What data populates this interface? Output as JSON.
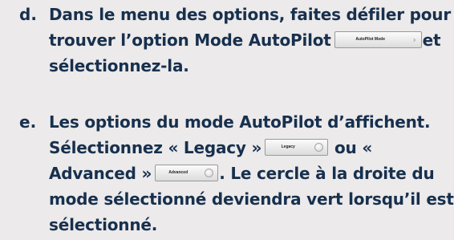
{
  "steps": [
    {
      "marker": "d.",
      "line1": "Dans le menu des options, faites défiler pour",
      "line2_before": "trouver l’option Mode AutoPilot",
      "line2_after": "et",
      "line3": "sélectionnez-la."
    },
    {
      "marker": "e.",
      "line1": "Les options du mode AutoPilot d’affichent.",
      "line2_before": "Sélectionnez « Legacy »",
      "line2_after": "ou «",
      "line3_before": "Advanced »",
      "line3_after": ". Le cercle à la droite du",
      "line4": "mode sélectionné deviendra vert lorsqu’il est",
      "line5": "sélectionné."
    }
  ],
  "buttons": {
    "autopilot_mode": {
      "label": "AutoPilot Mode",
      "icon": "chevron-right-icon"
    },
    "legacy": {
      "label": "Legacy",
      "icon": "radio-circle-icon"
    },
    "advanced": {
      "label": "Advanced",
      "icon": "radio-circle-icon"
    }
  },
  "colors": {
    "text": "#17304e",
    "background": "#eceaea"
  }
}
